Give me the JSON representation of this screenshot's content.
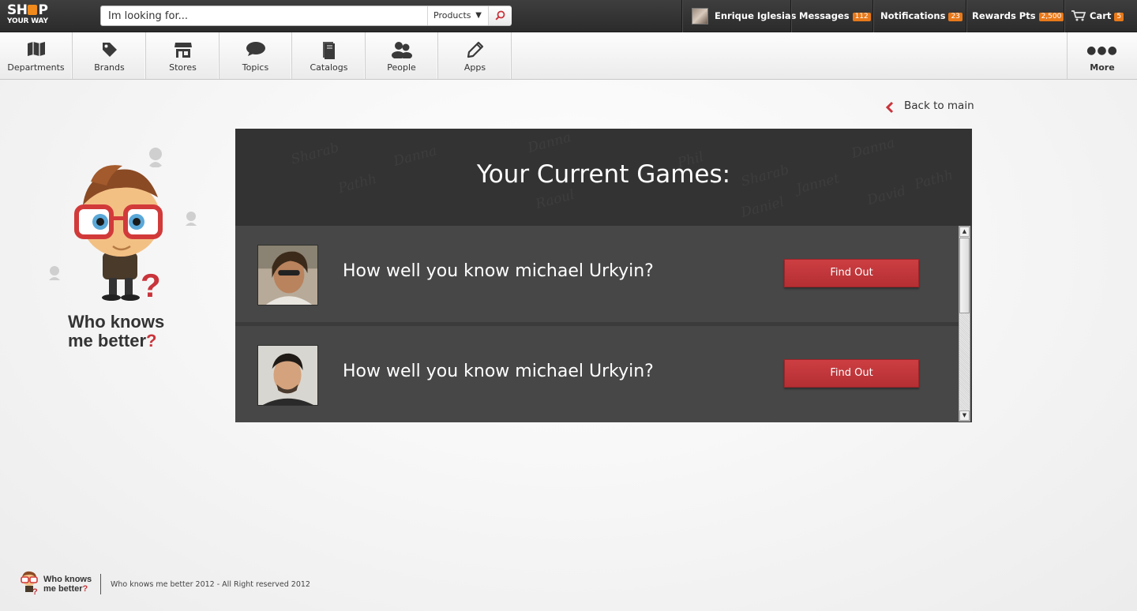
{
  "brand": {
    "logo_line1": "SHOP",
    "logo_line2": "YOUR WAY"
  },
  "search": {
    "placeholder": "Im looking for...",
    "category": "Products"
  },
  "topnav": {
    "user_name": "Enrique Iglesias",
    "messages_label": "Messages",
    "messages_count": "112",
    "notifications_label": "Notifications",
    "notifications_count": "23",
    "rewards_label": "Rewards Pts",
    "rewards_count": "2,500",
    "cart_label": "Cart",
    "cart_count": "5"
  },
  "nav": {
    "items": [
      {
        "label": "Departments",
        "icon": "map-icon"
      },
      {
        "label": "Brands",
        "icon": "tag-icon"
      },
      {
        "label": "Stores",
        "icon": "store-icon"
      },
      {
        "label": "Topics",
        "icon": "speech-bubble-icon"
      },
      {
        "label": "Catalogs",
        "icon": "catalog-icon"
      },
      {
        "label": "People",
        "icon": "people-icon"
      },
      {
        "label": "Apps",
        "icon": "pencil-icon"
      }
    ],
    "more_label": "More"
  },
  "back_link": "Back to main",
  "mascot": {
    "title_line1": "Who knows",
    "title_line2": "me better",
    "title_mark": "?"
  },
  "panel": {
    "title": "Your Current Games:",
    "games": [
      {
        "question": "How well you know michael Urkyin?",
        "button": "Find Out"
      },
      {
        "question": "How well you know michael Urkyin?",
        "button": "Find Out"
      }
    ]
  },
  "footer": {
    "brand_line1": "Who knows",
    "brand_line2": "me better",
    "brand_mark": "?",
    "copyright": "Who knows me better 2012 - All Right reserved 2012"
  },
  "colors": {
    "accent_red": "#c9343b",
    "badge_orange": "#e8791a",
    "topbar": "#333333",
    "panel": "#3b3b3b"
  }
}
